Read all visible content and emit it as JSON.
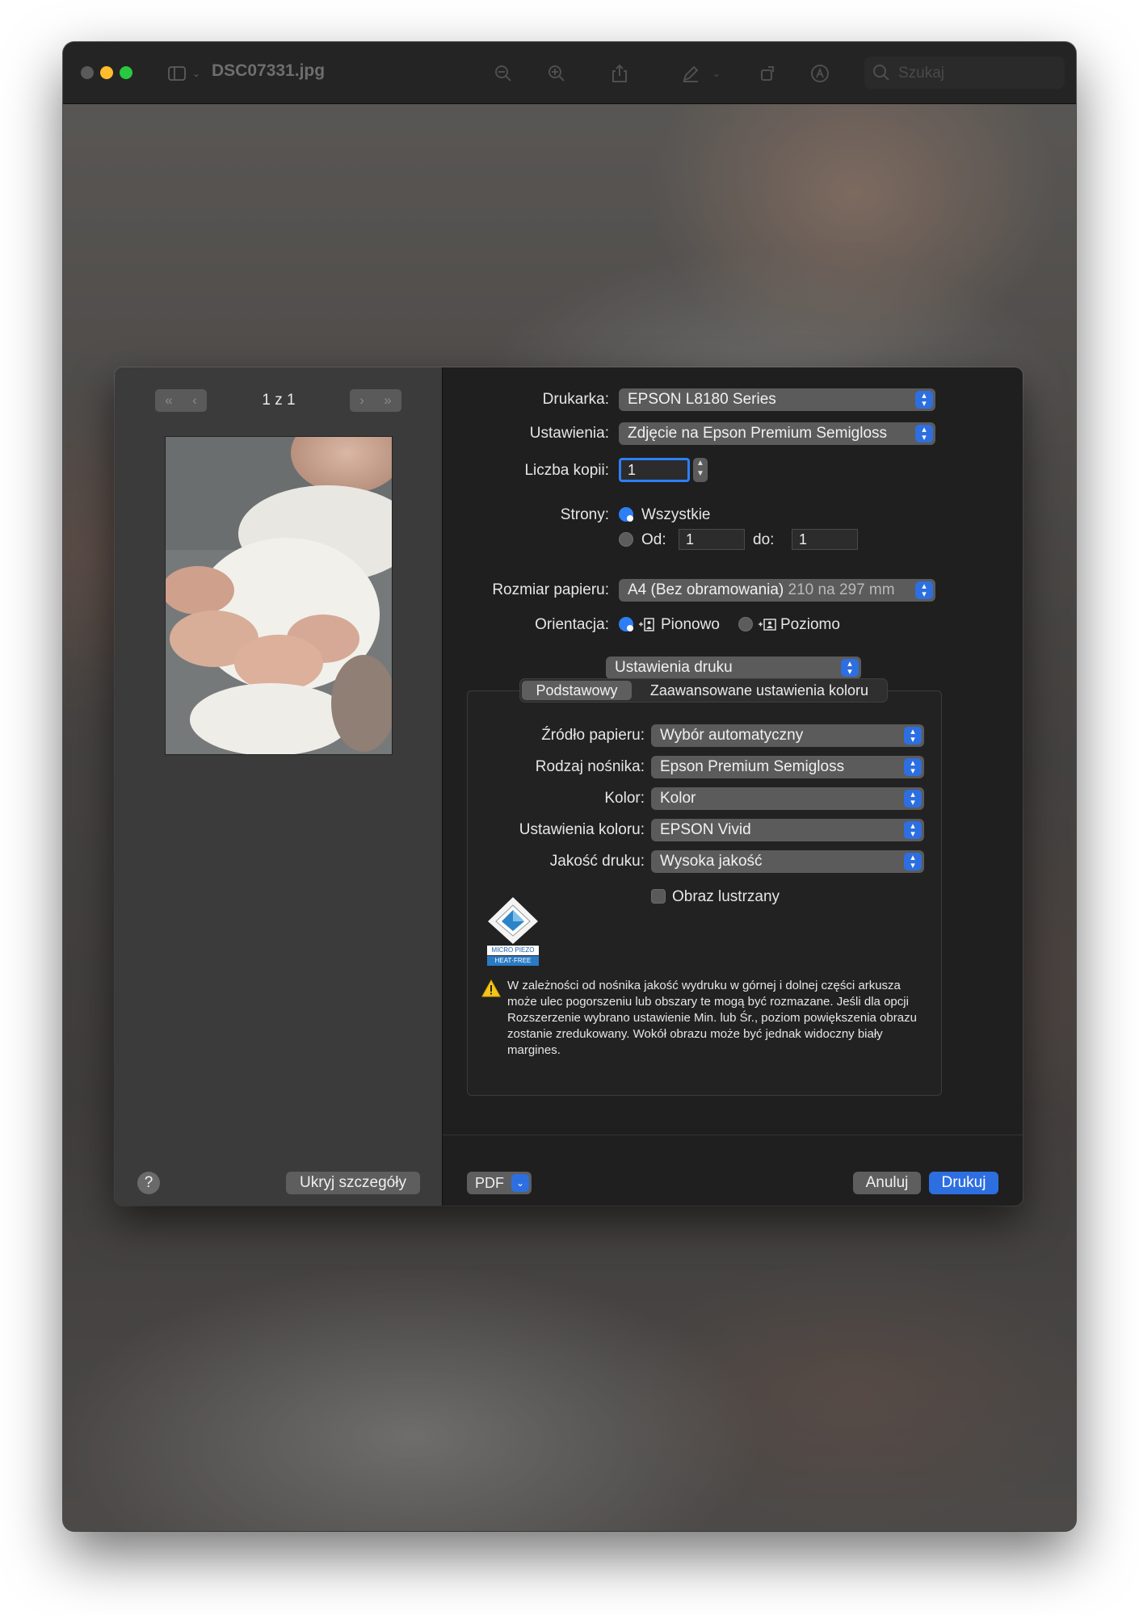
{
  "window": {
    "title": "DSC07331.jpg",
    "search_placeholder": "Szukaj"
  },
  "toolbar": {
    "icons": [
      "sidebar-icon",
      "chevron-down-icon",
      "zoom-out-icon",
      "zoom-in-icon",
      "share-icon",
      "markup-pen-icon",
      "chevron-down-icon",
      "rotate-icon",
      "annotate-icon",
      "search-icon"
    ]
  },
  "preview": {
    "page_indicator": "1 z 1",
    "hide_details_label": "Ukryj szczegóły",
    "help_label": "?"
  },
  "print": {
    "printer_label": "Drukarka:",
    "printer_value": "EPSON L8180 Series",
    "presets_label": "Ustawienia:",
    "presets_value": "Zdjęcie na Epson Premium Semigloss",
    "copies_label": "Liczba kopii:",
    "copies_value": "1",
    "pages_label": "Strony:",
    "pages_all": "Wszystkie",
    "pages_from_label": "Od:",
    "pages_from_value": "1",
    "pages_to_label": "do:",
    "pages_to_value": "1",
    "paper_size_label": "Rozmiar papieru:",
    "paper_size_value": "A4 (Bez obramowania)",
    "paper_size_dims": "210 na 297 mm",
    "orientation_label": "Orientacja:",
    "orientation_portrait": "Pionowo",
    "orientation_landscape": "Poziomo",
    "section_value": "Ustawienia druku",
    "tab_basic": "Podstawowy",
    "tab_advanced": "Zaawansowane ustawienia koloru",
    "paper_source_label": "Źródło papieru:",
    "paper_source_value": "Wybór automatyczny",
    "media_type_label": "Rodzaj nośnika:",
    "media_type_value": "Epson Premium Semigloss",
    "color_label": "Kolor:",
    "color_value": "Kolor",
    "color_settings_label": "Ustawienia koloru:",
    "color_settings_value": "EPSON Vivid",
    "quality_label": "Jakość druku:",
    "quality_value": "Wysoka jakość",
    "mirror_label": "Obraz lustrzany",
    "logo_text_1": "MICRO PIEZO",
    "logo_text_2": "HEAT·FREE",
    "warning_text": "W zależności od nośnika jakość wydruku w górnej i dolnej części arkusza może ulec pogorszeniu lub obszary te mogą być rozmazane. Jeśli dla opcji Rozszerzenie wybrano ustawienie Min. lub Śr., poziom powiększenia obrazu zostanie zredukowany. Wokół obrazu może być jednak widoczny biały margines."
  },
  "footer": {
    "pdf_label": "PDF",
    "cancel_label": "Anuluj",
    "print_label": "Drukuj"
  },
  "colors": {
    "accent": "#2d7ff5",
    "close": "#ff5f57",
    "minimize": "#febc2e",
    "zoom": "#28c840",
    "warning": "#f5c518"
  }
}
